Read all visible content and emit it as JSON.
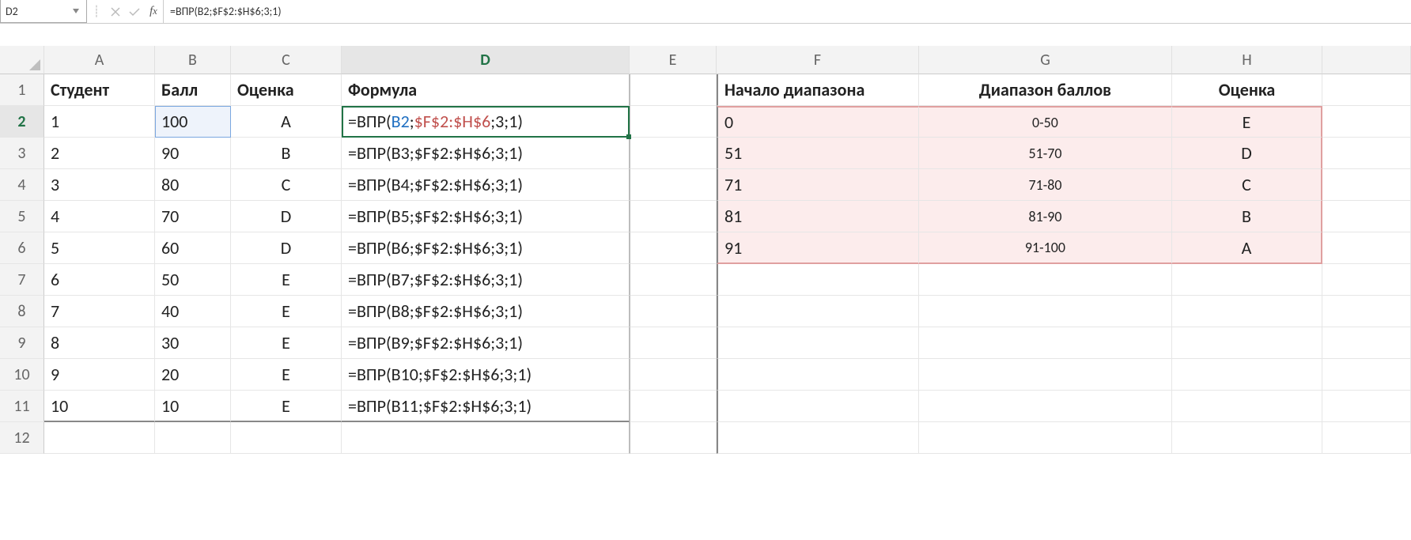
{
  "namebox": "D2",
  "formula_bar": "=ВПР(B2;$F$2:$H$6;3;1)",
  "columns": [
    "A",
    "B",
    "C",
    "D",
    "E",
    "F",
    "G",
    "H"
  ],
  "row_numbers": [
    "1",
    "2",
    "3",
    "4",
    "5",
    "6",
    "7",
    "8",
    "9",
    "10",
    "11",
    "12"
  ],
  "headers": {
    "A": "Студент",
    "B": "Балл",
    "C": "Оценка",
    "D": "Формула",
    "F": "Начало диапазона",
    "G": "Диапазон баллов",
    "H": "Оценка"
  },
  "students": [
    {
      "n": "1",
      "score": "100",
      "grade": "A",
      "formula_pre": "=ВПР(",
      "arg1": "B2",
      "sep1": ";",
      "arg2": "$F$2:$H$6",
      "rest": ";3;1)"
    },
    {
      "n": "2",
      "score": "90",
      "grade": "B",
      "formula": "=ВПР(B3;$F$2:$H$6;3;1)"
    },
    {
      "n": "3",
      "score": "80",
      "grade": "C",
      "formula": "=ВПР(B4;$F$2:$H$6;3;1)"
    },
    {
      "n": "4",
      "score": "70",
      "grade": "D",
      "formula": "=ВПР(B5;$F$2:$H$6;3;1)"
    },
    {
      "n": "5",
      "score": "60",
      "grade": "D",
      "formula": "=ВПР(B6;$F$2:$H$6;3;1)"
    },
    {
      "n": "6",
      "score": "50",
      "grade": "E",
      "formula": "=ВПР(B7;$F$2:$H$6;3;1)"
    },
    {
      "n": "7",
      "score": "40",
      "grade": "E",
      "formula": "=ВПР(B8;$F$2:$H$6;3;1)"
    },
    {
      "n": "8",
      "score": "30",
      "grade": "E",
      "formula": "=ВПР(B9;$F$2:$H$6;3;1)"
    },
    {
      "n": "9",
      "score": "20",
      "grade": "E",
      "formula": "=ВПР(B10;$F$2:$H$6;3;1)"
    },
    {
      "n": "10",
      "score": "10",
      "grade": "E",
      "formula": "=ВПР(B11;$F$2:$H$6;3;1)"
    }
  ],
  "lookup": [
    {
      "start": "0",
      "range": "0-50",
      "grade": "E"
    },
    {
      "start": "51",
      "range": "51-70",
      "grade": "D"
    },
    {
      "start": "71",
      "range": "71-80",
      "grade": "C"
    },
    {
      "start": "81",
      "range": "81-90",
      "grade": "B"
    },
    {
      "start": "91",
      "range": "91-100",
      "grade": "A"
    }
  ]
}
